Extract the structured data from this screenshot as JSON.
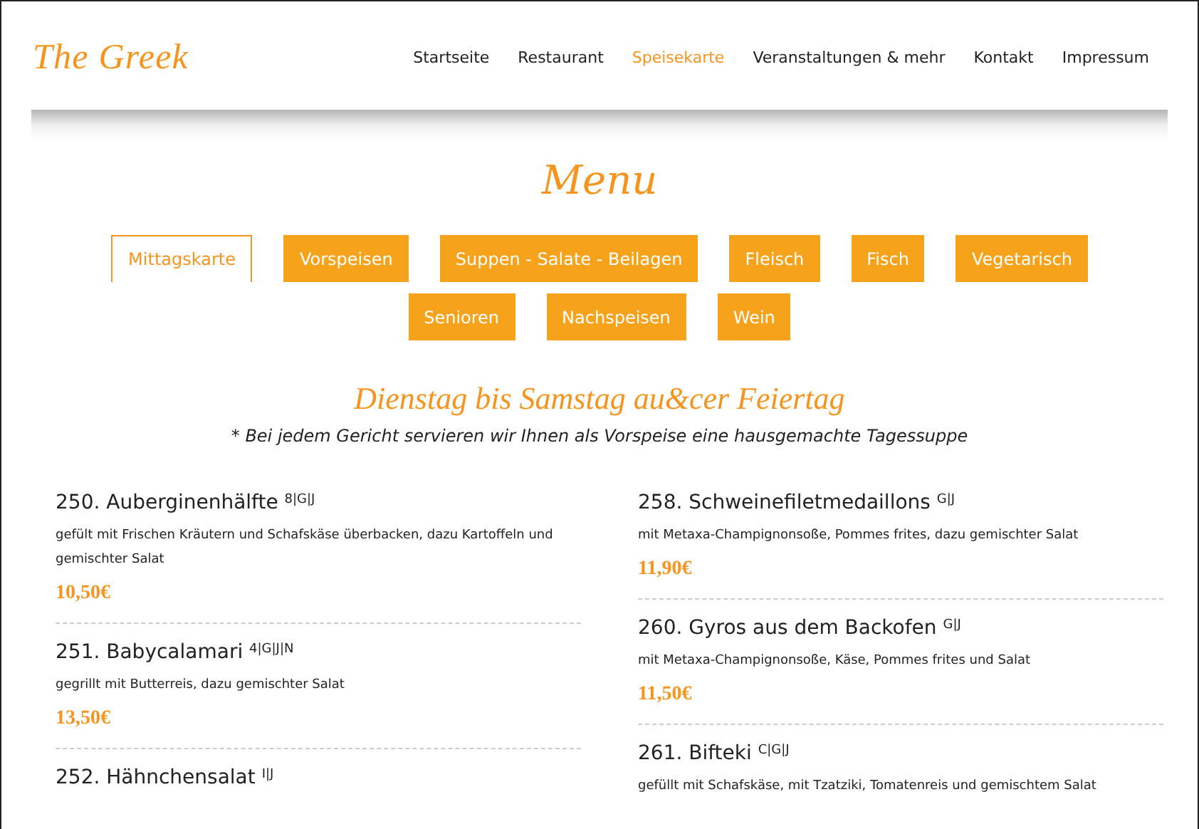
{
  "logo": "The Greek",
  "nav": [
    {
      "label": "Startseite",
      "selected": false
    },
    {
      "label": "Restaurant",
      "selected": false
    },
    {
      "label": "Speisekarte",
      "selected": true
    },
    {
      "label": "Veranstaltungen & mehr",
      "selected": false
    },
    {
      "label": "Kontakt",
      "selected": false
    },
    {
      "label": "Impressum",
      "selected": false
    }
  ],
  "heading": "Menu",
  "tab_rows": [
    [
      {
        "label": "Mittagskarte",
        "selected": true
      },
      {
        "label": "Vorspeisen",
        "selected": false
      },
      {
        "label": "Suppen - Salate - Beilagen",
        "selected": false
      },
      {
        "label": "Fleisch",
        "selected": false
      },
      {
        "label": "Fisch",
        "selected": false
      },
      {
        "label": "Vegetarisch",
        "selected": false
      }
    ],
    [
      {
        "label": "Senioren",
        "selected": false
      },
      {
        "label": "Nachspeisen",
        "selected": false
      },
      {
        "label": "Wein",
        "selected": false
      }
    ]
  ],
  "section_title": "Dienstag bis Samstag au&cer Feiertag",
  "note": "* Bei jedem Gericht servieren wir Ihnen als Vorspeise eine hausgemachte Tagessuppe",
  "columns": [
    [
      {
        "title": "250. Auberginenhälfte $^{8|G|J}$",
        "description": "gefült mit Frischen Kräutern und Schafskäse überbacken, dazu Kartoffeln und gemischter Salat",
        "price": "10,50€"
      },
      {
        "title": "251. Babycalamari $^{4|G|J|N}$",
        "description": "gegrillt mit Butterreis, dazu gemischter Salat",
        "price": "13,50€"
      },
      {
        "title": "252. Hähnchensalat $^{I|J}$"
      }
    ],
    [
      {
        "title": "258. Schweinefiletmedaillons $^{G|J}$",
        "description": "mit Metaxa-Champignonsoße, Pommes frites, dazu gemischter Salat",
        "price": "11,90€"
      },
      {
        "title": "260. Gyros aus dem Backofen $^{G|J}$",
        "description": "mit Metaxa-Champignonsoße, Käse, Pommes frites und Salat",
        "price": "11,50€"
      },
      {
        "title": "261. Bifteki $^{C|G|J}$",
        "description": "gefüllt mit Schafskäse, mit Tzatziki, Tomatenreis und gemischtem Salat"
      }
    ]
  ]
}
